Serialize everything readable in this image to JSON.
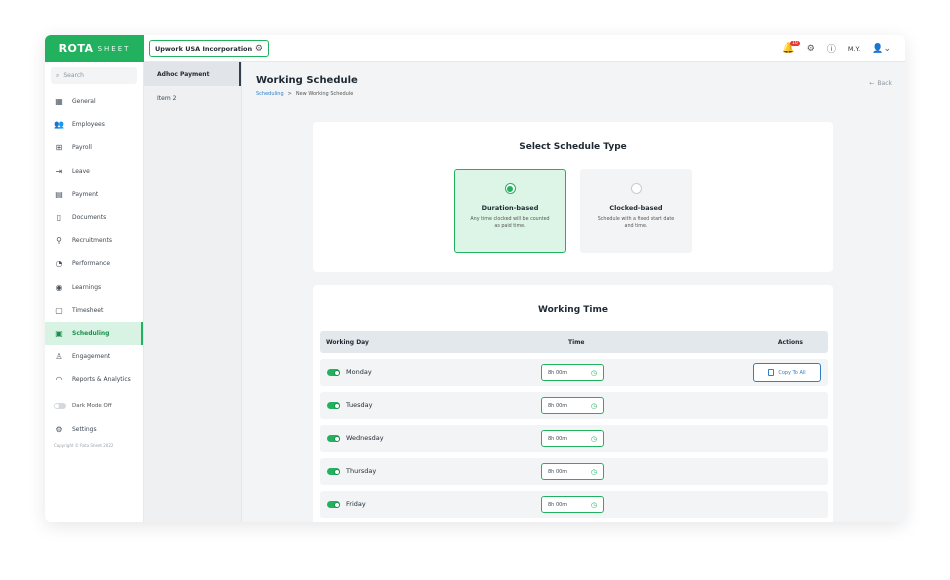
{
  "brand": {
    "name": "ROTA",
    "suffix": "SHEET"
  },
  "company": {
    "name": "Upwork USA Incorporation",
    "icon": "gear-icon"
  },
  "topbar": {
    "notification_count": "10",
    "user_initials": "M.Y."
  },
  "sidebar": {
    "search_placeholder": "Search",
    "items": [
      {
        "label": "General",
        "icon": "grid-icon"
      },
      {
        "label": "Employees",
        "icon": "users-icon"
      },
      {
        "label": "Payroll",
        "icon": "payroll-icon"
      },
      {
        "label": "Leave",
        "icon": "exit-icon"
      },
      {
        "label": "Payment",
        "icon": "payment-icon"
      },
      {
        "label": "Documents",
        "icon": "document-icon"
      },
      {
        "label": "Recruitments",
        "icon": "search-person-icon"
      },
      {
        "label": "Performance",
        "icon": "gauge-icon"
      },
      {
        "label": "Learnings",
        "icon": "badge-icon"
      },
      {
        "label": "Timesheet",
        "icon": "timesheet-icon"
      },
      {
        "label": "Scheduling",
        "icon": "calendar-clock-icon",
        "active": true
      },
      {
        "label": "Engagement",
        "icon": "engagement-icon"
      },
      {
        "label": "Reports & Analytics",
        "icon": "chart-icon"
      }
    ],
    "dark_mode_label": "Dark Mode Off",
    "settings_label": "Settings",
    "copyright": "Copyright © Rota Sheet 2022"
  },
  "submenu": {
    "items": [
      {
        "label": "Adhoc Payment",
        "active": true
      },
      {
        "label": "Item 2"
      }
    ]
  },
  "page": {
    "title": "Working Schedule",
    "breadcrumb_root": "Scheduling",
    "breadcrumb_sep": ">",
    "breadcrumb_current": "New Working Schedule",
    "back_label": "Back"
  },
  "schedule_type": {
    "title": "Select Schedule Type",
    "options": [
      {
        "title": "Duration-based",
        "desc": "Any time clocked will be counted as paid time.",
        "selected": true
      },
      {
        "title": "Clocked-based",
        "desc": "Schedule with a fixed start date and time.",
        "selected": false
      }
    ]
  },
  "working_time": {
    "title": "Working Time",
    "headers": {
      "day": "Working Day",
      "time": "Time",
      "actions": "Actions"
    },
    "copy_label": "Copy To All",
    "rows": [
      {
        "day": "Monday",
        "time": "8h 00m",
        "enabled": true
      },
      {
        "day": "Tuesday",
        "time": "8h 00m",
        "enabled": true
      },
      {
        "day": "Wednesday",
        "time": "8h 00m",
        "enabled": true
      },
      {
        "day": "Thursday",
        "time": "8h 00m",
        "enabled": true
      },
      {
        "day": "Friday",
        "time": "8h 00m",
        "enabled": true
      }
    ]
  },
  "colors": {
    "accent": "#22b25f",
    "link": "#2f80c8"
  }
}
